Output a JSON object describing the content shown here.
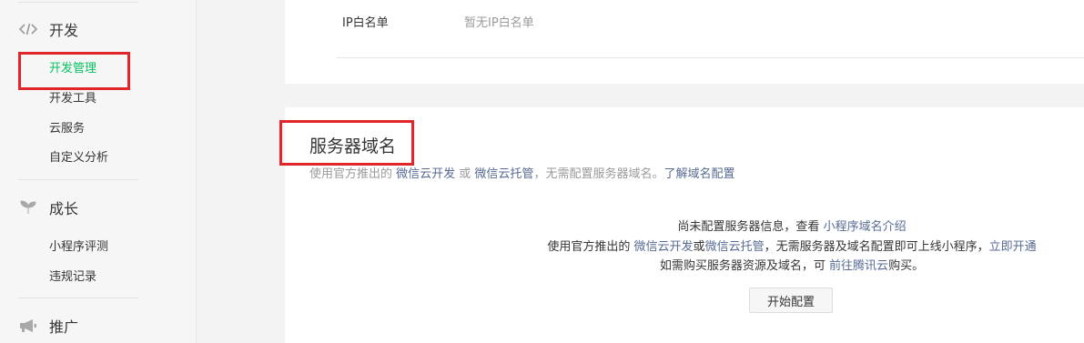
{
  "sidebar": {
    "develop": {
      "title": "开发",
      "icon": "code-icon",
      "items": [
        "开发管理",
        "开发工具",
        "云服务",
        "自定义分析"
      ]
    },
    "grow": {
      "title": "成长",
      "icon": "sprout-icon",
      "items": [
        "小程序评测",
        "违规记录"
      ]
    },
    "promote": {
      "title": "推广",
      "icon": "megaphone-icon"
    }
  },
  "ip_whitelist": {
    "label": "IP白名单",
    "value": "暂无IP白名单"
  },
  "server_domain": {
    "title": "服务器域名",
    "desc_prefix": "使用官方推出的 ",
    "link_cloud_dev": "微信云开发",
    "desc_or": " 或 ",
    "link_cloud_host": "微信云托管",
    "desc_suffix": "，无需配置服务器域名。",
    "link_learn": "了解域名配置",
    "empty_line1_text": "尚未配置服务器信息，查看 ",
    "empty_line1_link": "小程序域名介绍",
    "empty_line2_prefix": "使用官方推出的 ",
    "empty_line2_link1": "微信云开发",
    "empty_line2_or": "或",
    "empty_line2_link2": "微信云托管",
    "empty_line2_mid": "，无需服务器及域名配置即可上线小程序，",
    "empty_line2_link3": "立即开通",
    "empty_line3_prefix": "如需购买服务器资源及域名，可 ",
    "empty_line3_link": "前往腾讯云",
    "empty_line3_suffix": "购买。",
    "start_button": "开始配置"
  },
  "colors": {
    "active": "#07c160",
    "link": "#576b95",
    "highlight_box": "#e0262a"
  }
}
